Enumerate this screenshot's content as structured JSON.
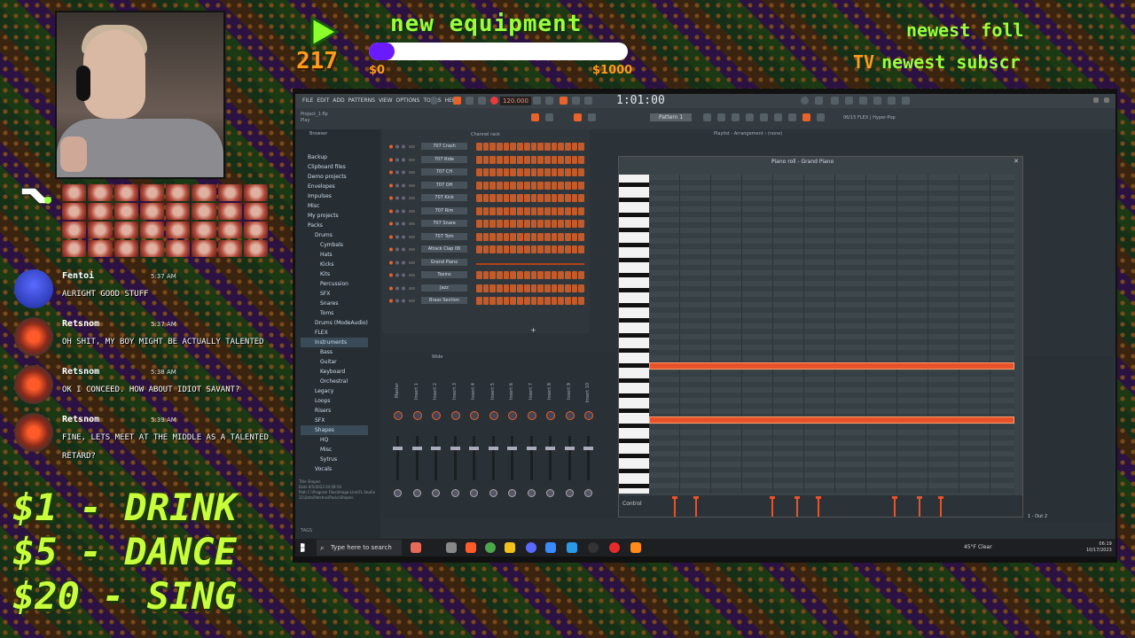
{
  "overlay": {
    "donation_count": "217",
    "goal_title": "new equipment",
    "goal_min": "$0",
    "goal_max": "$1000",
    "goal_progress": 0.1,
    "newest_follower_label": "newest foll",
    "newest_sub_label": "newest subscr",
    "newest_sub_icon": "TV",
    "prices": [
      "$1 - DRINK",
      "$5 - DANCE",
      "$20 - SING"
    ]
  },
  "chat": [
    {
      "user": "Fentoi",
      "time": "5:37 AM",
      "text": "ALRIGHT GOOD STUFF",
      "avatar": "blue"
    },
    {
      "user": "Retsnom",
      "time": "5:37 AM",
      "text": "OH SHIT, MY BOY MIGHT BE ACTUALLY TALENTED",
      "avatar": "red"
    },
    {
      "user": "Retsnom",
      "time": "5:38 AM",
      "text": "OK I CONCEED. HOW ABOUT IDIOT SAVANT?",
      "avatar": "red"
    },
    {
      "user": "Retsnom",
      "time": "5:39 AM",
      "text": "FINE, LETS MEET AT THE MIDDLE AS A TALENTED RETARD?",
      "avatar": "red"
    }
  ],
  "fl": {
    "menu": [
      "FILE",
      "EDIT",
      "ADD",
      "PATTERNS",
      "VIEW",
      "OPTIONS",
      "TOOLS",
      "HELP"
    ],
    "tempo": "120.000",
    "time": "1:01:00",
    "project_name": "Project_1.flp",
    "project_state": "Play",
    "pattern": "Pattern 1",
    "hint": "06/15 FLEX | Hyper-Pop",
    "browser_title": "Browser",
    "browser_items": [
      {
        "label": "Backup",
        "level": 1
      },
      {
        "label": "Clipboard files",
        "level": 1
      },
      {
        "label": "Demo projects",
        "level": 1
      },
      {
        "label": "Envelopes",
        "level": 1
      },
      {
        "label": "Impulses",
        "level": 1
      },
      {
        "label": "Misc",
        "level": 1
      },
      {
        "label": "My projects",
        "level": 1
      },
      {
        "label": "Packs",
        "level": 1
      },
      {
        "label": "Drums",
        "level": 2
      },
      {
        "label": "Cymbals",
        "level": 3
      },
      {
        "label": "Hats",
        "level": 3
      },
      {
        "label": "Kicks",
        "level": 3
      },
      {
        "label": "Kits",
        "level": 3
      },
      {
        "label": "Percussion",
        "level": 3
      },
      {
        "label": "SFX",
        "level": 3
      },
      {
        "label": "Snares",
        "level": 3
      },
      {
        "label": "Toms",
        "level": 3
      },
      {
        "label": "Drums (ModeAudio)",
        "level": 2
      },
      {
        "label": "FLEX",
        "level": 2
      },
      {
        "label": "Instruments",
        "level": 2
      },
      {
        "label": "Bass",
        "level": 3
      },
      {
        "label": "Guitar",
        "level": 3
      },
      {
        "label": "Keyboard",
        "level": 3
      },
      {
        "label": "Orchestral",
        "level": 3
      },
      {
        "label": "Legacy",
        "level": 2
      },
      {
        "label": "Loops",
        "level": 2
      },
      {
        "label": "Risers",
        "level": 2
      },
      {
        "label": "SFX",
        "level": 2
      },
      {
        "label": "Shapes",
        "level": 2
      },
      {
        "label": "HQ",
        "level": 3
      },
      {
        "label": "Misc",
        "level": 3
      },
      {
        "label": "Sytrus",
        "level": 3
      },
      {
        "label": "Vocals",
        "level": 2
      }
    ],
    "browser_info": [
      "Title   Shapes",
      "Date    6/5/2023 04:08:50",
      "Path    C:\\Program Files\\Image-Line\\FL Studio 21\\Data\\Patches\\Packs\\Shapes"
    ],
    "browser_tags": "TAGS",
    "channel_rack_title": "Channel rack",
    "channels": [
      "707 Crash",
      "707 Ride",
      "707 CH",
      "707 OH",
      "707 Kick",
      "707 Rim",
      "707 Snare",
      "707 Tom",
      "Attack Clap 06",
      "Grand Piano",
      "Toxins",
      "Jazz",
      "Brass Section"
    ],
    "mixer_title": "Wide",
    "mixer_tracks": [
      "Master",
      "Insert 1",
      "Insert 2",
      "Insert 3",
      "Insert 4",
      "Insert 5",
      "Insert 6",
      "Insert 7",
      "Insert 8",
      "Insert 9",
      "Insert 10"
    ],
    "playlist_title": "Playlist - Arrangement › (none)",
    "piano_roll_title": "Piano roll - Grand Piano",
    "piano_roll_control": "Control",
    "right_panel_out": "1 - Out 2"
  },
  "taskbar": {
    "search_placeholder": "Type here to search",
    "weather": "45°F Clear",
    "time": "06:19",
    "date": "10/17/2023"
  }
}
